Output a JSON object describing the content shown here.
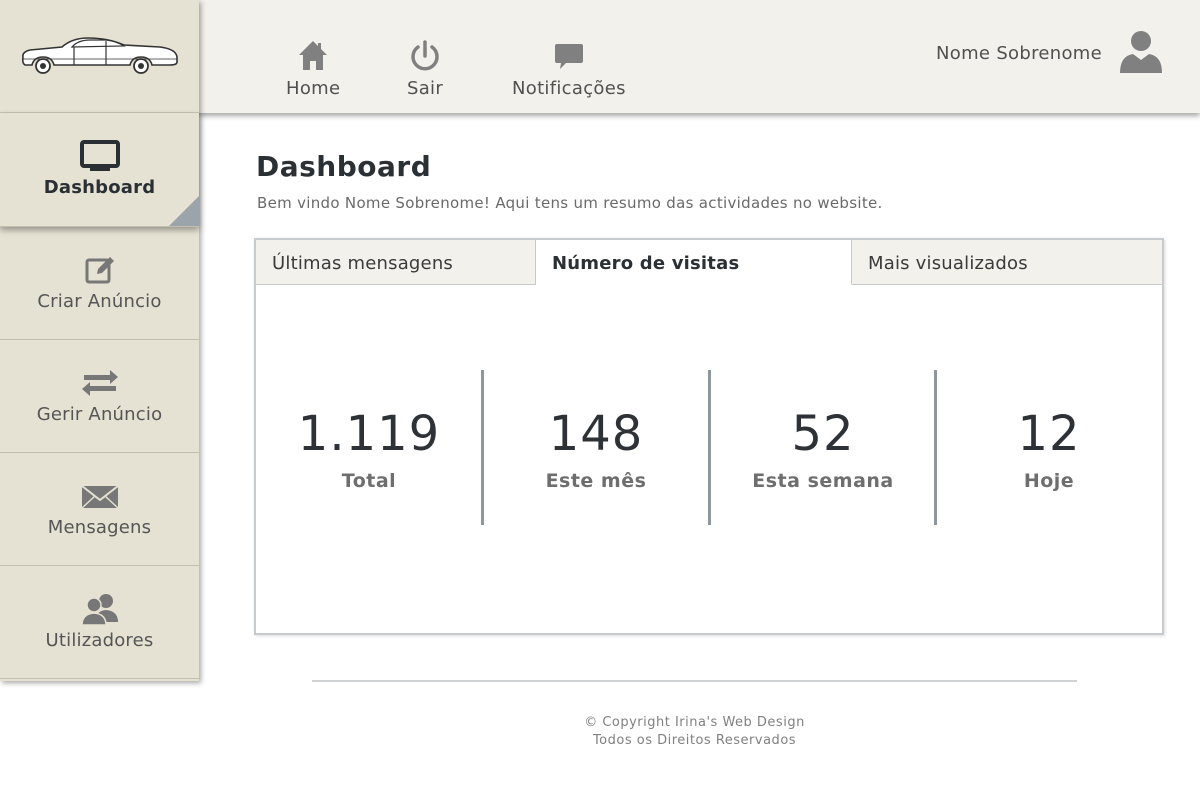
{
  "header": {
    "nav": [
      {
        "label": "Home",
        "icon": "home-icon"
      },
      {
        "label": "Sair",
        "icon": "power-icon"
      },
      {
        "label": "Notificações",
        "icon": "chat-icon"
      }
    ],
    "user_name": "Nome Sobrenome",
    "user_icon": "user-avatar-icon"
  },
  "sidebar": {
    "logo_icon": "car-logo-icon",
    "items": [
      {
        "label": "Dashboard",
        "icon": "monitor-icon",
        "active": true
      },
      {
        "label": "Criar Anúncio",
        "icon": "edit-icon"
      },
      {
        "label": "Gerir Anúncio",
        "icon": "swap-arrows-icon"
      },
      {
        "label": "Mensagens",
        "icon": "envelope-icon"
      },
      {
        "label": "Utilizadores",
        "icon": "users-icon"
      }
    ]
  },
  "main": {
    "title": "Dashboard",
    "welcome": "Bem vindo Nome Sobrenome! Aqui tens um resumo das actividades no website.",
    "tabs": [
      {
        "label": "Últimas mensagens",
        "active": false
      },
      {
        "label": "Número de visitas",
        "active": true
      },
      {
        "label": "Mais visualizados",
        "active": false
      }
    ],
    "stats": [
      {
        "value": "1.119",
        "label": "Total"
      },
      {
        "value": "148",
        "label": "Este mês"
      },
      {
        "value": "52",
        "label": "Esta semana"
      },
      {
        "value": "12",
        "label": "Hoje"
      }
    ]
  },
  "footer": {
    "copyright": "© Copyright Irina's Web Design",
    "rights": "Todos os Direitos Reservados"
  },
  "colors": {
    "header_bg": "#f3f1ec",
    "sidebar_bg": "#e5e2d3",
    "accent": "#9ba4ab",
    "text_dark": "#2b3035"
  }
}
